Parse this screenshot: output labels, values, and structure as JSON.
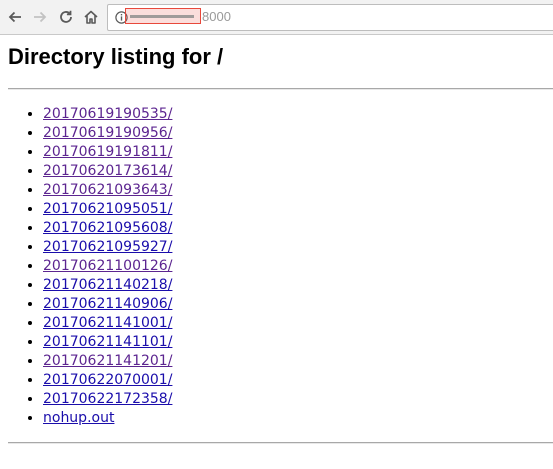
{
  "browser": {
    "url_visible": "8000"
  },
  "page": {
    "heading": "Directory listing for /",
    "entries": [
      {
        "name": "20170619190535/",
        "visited": true
      },
      {
        "name": "20170619190956/",
        "visited": true
      },
      {
        "name": "20170619191811/",
        "visited": true
      },
      {
        "name": "20170620173614/",
        "visited": true
      },
      {
        "name": "20170621093643/",
        "visited": true
      },
      {
        "name": "20170621095051/",
        "visited": false
      },
      {
        "name": "20170621095608/",
        "visited": false
      },
      {
        "name": "20170621095927/",
        "visited": false
      },
      {
        "name": "20170621100126/",
        "visited": true
      },
      {
        "name": "20170621140218/",
        "visited": false
      },
      {
        "name": "20170621140906/",
        "visited": false
      },
      {
        "name": "20170621141001/",
        "visited": false
      },
      {
        "name": "20170621141101/",
        "visited": false
      },
      {
        "name": "20170621141201/",
        "visited": true
      },
      {
        "name": "20170622070001/",
        "visited": false
      },
      {
        "name": "20170622172358/",
        "visited": false
      },
      {
        "name": "nohup.out",
        "visited": false
      }
    ]
  },
  "colors": {
    "link": "#1a0dab",
    "visited_link": "#5c2590",
    "redaction": "#e8483b"
  },
  "icons": [
    "back-arrow-icon",
    "forward-arrow-icon",
    "reload-icon",
    "home-icon",
    "info-icon"
  ]
}
